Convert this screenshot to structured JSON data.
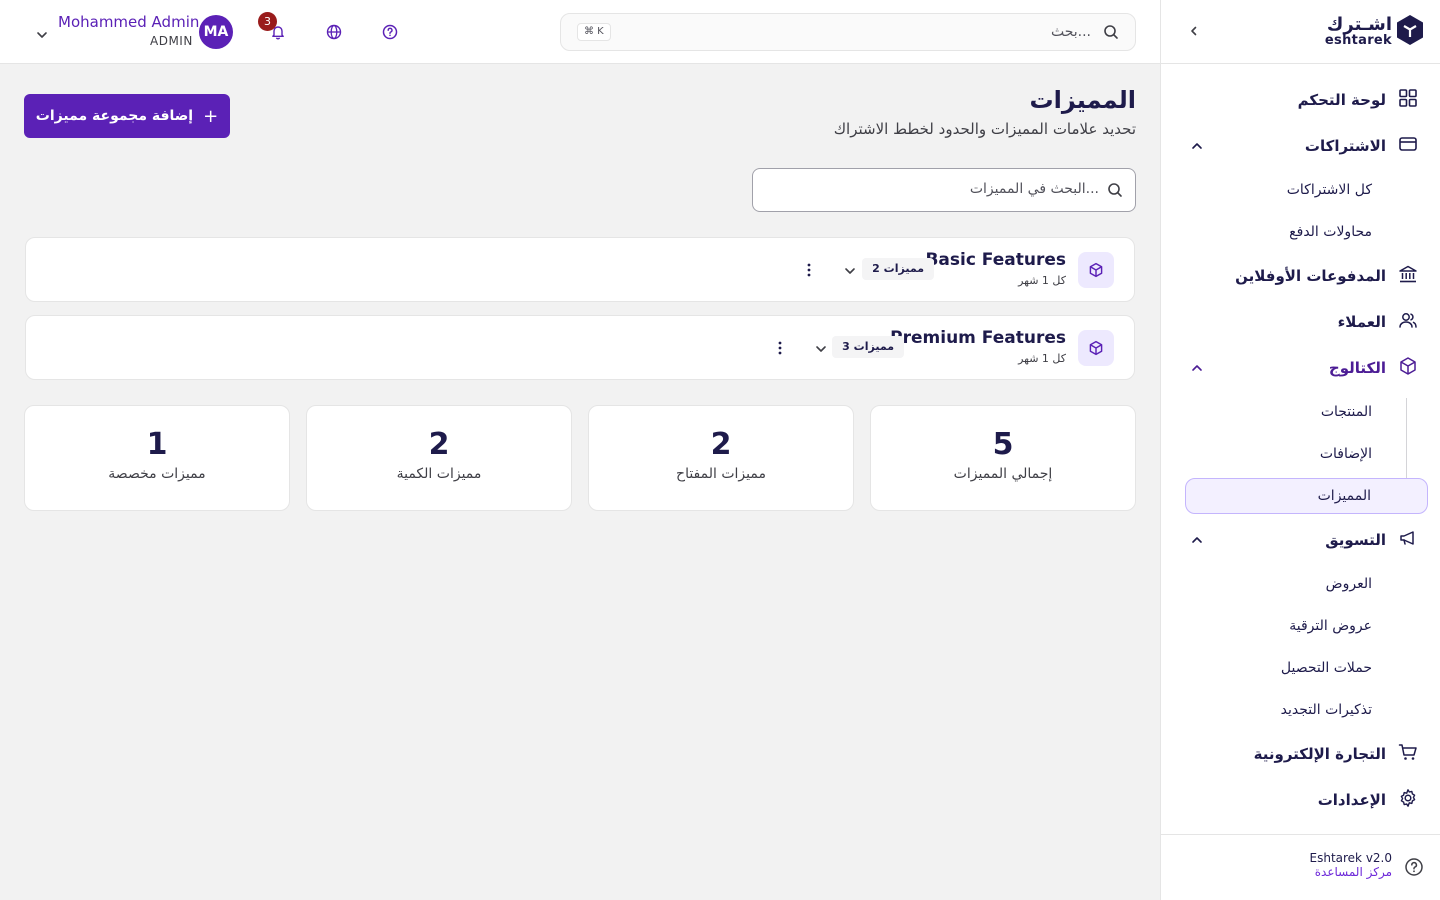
{
  "brand": {
    "name_ar": "اشـترك",
    "name_en": "eshtarek"
  },
  "topbar": {
    "search_placeholder": "بحث...",
    "shortcut": "⌘ K",
    "notifications_count": "3",
    "user": {
      "initials": "MA",
      "name": "Mohammed Admin",
      "role": "ADMIN"
    }
  },
  "sidebar": {
    "dashboard": "لوحة التحكم",
    "subscriptions": "الاشتراكات",
    "all_subscriptions": "كل الاشتراكات",
    "payment_attempts": "محاولات الدفع",
    "offline_payments": "المدفوعات الأوفلاين",
    "customers": "العملاء",
    "catalog": "الكتالوج",
    "products": "المنتجات",
    "addons": "الإضافات",
    "features": "المميزات",
    "marketing": "التسويق",
    "offers": "العروض",
    "upgrade_offers": "عروض الترقية",
    "collection_campaigns": "حملات التحصيل",
    "renewal_reminders": "تذكيرات التجديد",
    "ecommerce": "التجارة الإلكترونية",
    "settings": "الإعدادات",
    "version": "Eshtarek v2.0",
    "help_center": "مركز المساعدة"
  },
  "page": {
    "title": "المميزات",
    "subtitle": "تحديد علامات المميزات والحدود لخطط الاشتراك",
    "add_button": "إضافة مجموعة مميزات",
    "search_placeholder": "البحث في المميزات..."
  },
  "groups": [
    {
      "name": "Basic Features",
      "period": "كل 1 شهر",
      "count": "2 مميزات"
    },
    {
      "name": "Premium Features",
      "period": "كل 1 شهر",
      "count": "3 مميزات"
    }
  ],
  "stats": [
    {
      "value": "5",
      "label": "إجمالي المميزات"
    },
    {
      "value": "2",
      "label": "مميزات المفتاح"
    },
    {
      "value": "2",
      "label": "مميزات الكمية"
    },
    {
      "value": "1",
      "label": "مميزات مخصصة"
    }
  ],
  "colors": {
    "primary": "#5b21b6",
    "text": "#1e1b4b",
    "badge": "#991b1b",
    "background": "#f2f2f2"
  }
}
